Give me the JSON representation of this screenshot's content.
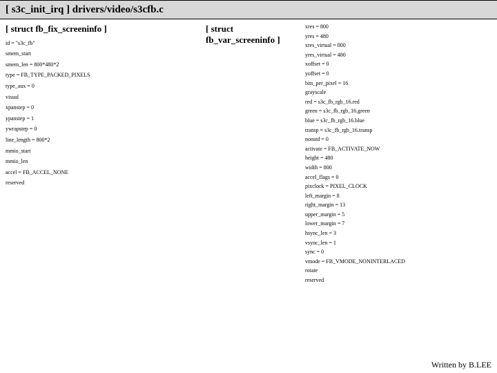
{
  "header": "[ s3c_init_irq ] drivers/video/s3cfb.c",
  "left": {
    "title": "[ struct fb_fix_screeninfo ]",
    "items": [
      "id = \"s3c_fb\"",
      "smem_start",
      "smem_len = 800*480*2",
      "type = FB_TYPE_PACKED_PIXELS",
      "type_aux = 0",
      "visual",
      "xpanstep = 0",
      "ypanstep = 1",
      "ywrapstep = 0",
      "line_length = 800*2",
      "mmio_start",
      "mmio_len",
      "accel = FB_ACCEL_NONE",
      "reserved"
    ]
  },
  "right": {
    "title": "[ struct fb_var_screeninfo ]",
    "items": [
      "xres = 800",
      "yres = 480",
      "xres_virtual = 800",
      "yres_virtual = 480",
      "xoffset = 0",
      "yoffset = 0",
      "bits_per_pixel = 16",
      "grayscale",
      "red = s3c_fb_rgb_16.red",
      "green = s3c_fb_rgb_16.green",
      "blue = s3c_fb_rgb_16.blue",
      "transp = s3c_fb_rgb_16.transp",
      "nonstd = 0",
      "activate = FB_ACTIVATE_NOW",
      "height = 480",
      "width = 800",
      "accel_flags = 0",
      "pixclock = PIXEL_CLOCK",
      "left_margin = 8",
      "right_margin = 13",
      "upper_margin = 5",
      "lower_margin = 7",
      "hsync_len = 3",
      "vsync_len = 1",
      "sync = 0",
      "vmode = FB_VMODE_NONINTERLACED",
      "rotate",
      "reserved"
    ]
  },
  "footer": "Written by B.LEE"
}
